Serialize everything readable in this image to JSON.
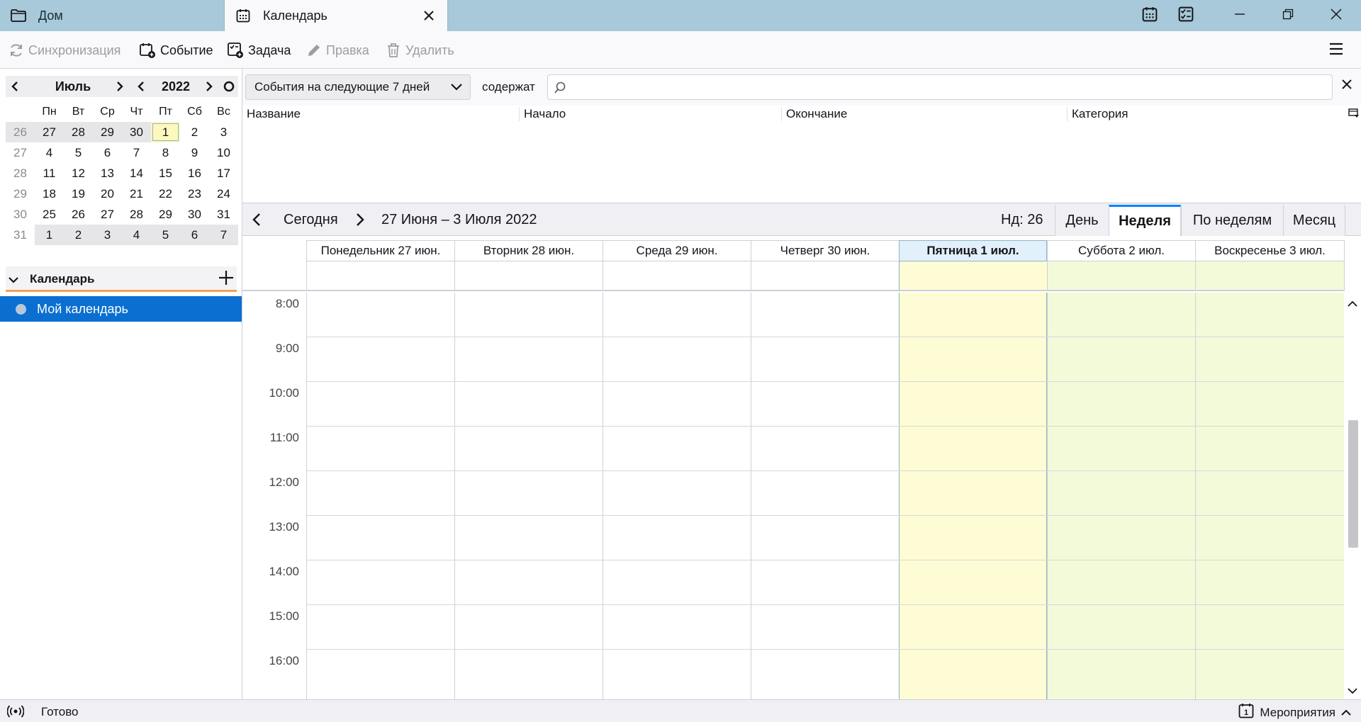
{
  "tabs": [
    {
      "label": "Дом",
      "icon": "folder-icon"
    },
    {
      "label": "Календарь",
      "icon": "calendar-icon"
    }
  ],
  "toolbar": {
    "sync": "Синхронизация",
    "event": "Событие",
    "task": "Задача",
    "edit": "Правка",
    "delete": "Удалить"
  },
  "minimonth": {
    "month": "Июль",
    "year": "2022",
    "weekdays": [
      "Пн",
      "Вт",
      "Ср",
      "Чт",
      "Пт",
      "Сб",
      "Вс"
    ],
    "weeks": [
      {
        "wk": "26",
        "days": [
          "27",
          "28",
          "29",
          "30",
          "1",
          "2",
          "3"
        ]
      },
      {
        "wk": "27",
        "days": [
          "4",
          "5",
          "6",
          "7",
          "8",
          "9",
          "10"
        ]
      },
      {
        "wk": "28",
        "days": [
          "11",
          "12",
          "13",
          "14",
          "15",
          "16",
          "17"
        ]
      },
      {
        "wk": "29",
        "days": [
          "18",
          "19",
          "20",
          "21",
          "22",
          "23",
          "24"
        ]
      },
      {
        "wk": "30",
        "days": [
          "25",
          "26",
          "27",
          "28",
          "29",
          "30",
          "31"
        ]
      },
      {
        "wk": "31",
        "days": [
          "1",
          "2",
          "3",
          "4",
          "5",
          "6",
          "7"
        ]
      }
    ]
  },
  "calendars": {
    "section_title": "Календарь",
    "items": [
      "Мой календарь"
    ]
  },
  "filter": {
    "select_value": "События на следующие 7 дней",
    "contains_label": "содержат",
    "search_value": ""
  },
  "eventlist": {
    "columns": [
      "Название",
      "Начало",
      "Окончание",
      "Категория"
    ]
  },
  "nav": {
    "today": "Сегодня",
    "range": "27 Июня – 3 Июля 2022",
    "week_number": "Нд: 26",
    "views": [
      "День",
      "Неделя",
      "По неделям",
      "Месяц"
    ],
    "active_view": "Неделя"
  },
  "week": {
    "days": [
      "Понедельник 27 июн.",
      "Вторник 28 июн.",
      "Среда 29 июн.",
      "Четверг 30 июн.",
      "Пятница 1 июл.",
      "Суббота 2 июл.",
      "Воскресенье 3 июл."
    ],
    "today_index": 4,
    "hours": [
      "8:00",
      "9:00",
      "10:00",
      "11:00",
      "12:00",
      "13:00",
      "14:00",
      "15:00",
      "16:00"
    ]
  },
  "status": {
    "text": "Готово",
    "events_label": "Мероприятия",
    "events_icon_day": "1"
  },
  "colors": {
    "accent": "#0a84ff",
    "selected": "#0a6fd0",
    "today_bg": "#fefcd4",
    "weekend_bg": "#f3fad9",
    "titlebar": "#a7c9d9",
    "section_underline": "#f0a25a"
  }
}
